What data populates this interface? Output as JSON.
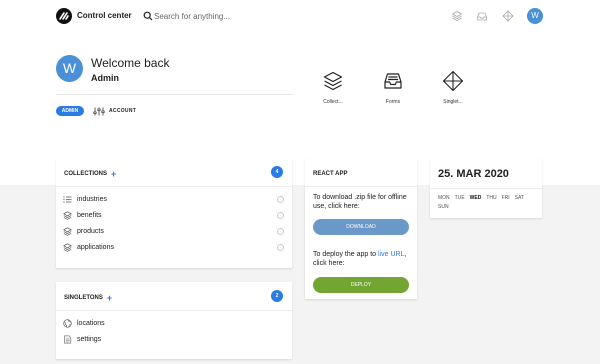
{
  "topbar": {
    "app_title": "Control center",
    "search_placeholder": "Search for anything...",
    "avatar_letter": "W"
  },
  "welcome": {
    "avatar_letter": "W",
    "greeting": "Welcome back",
    "username": "Admin",
    "role_badge": "ADMIN",
    "account_label": "ACCOUNT"
  },
  "quick_links": [
    {
      "label": "Collect...",
      "icon": "layers-icon"
    },
    {
      "label": "Forms",
      "icon": "inbox-icon"
    },
    {
      "label": "Singlet...",
      "icon": "diamond-icon"
    }
  ],
  "collections": {
    "title": "COLLECTIONS",
    "count": "4",
    "items": [
      {
        "label": "industries",
        "icon": "list-icon"
      },
      {
        "label": "benefits",
        "icon": "layers-icon"
      },
      {
        "label": "products",
        "icon": "layers-icon"
      },
      {
        "label": "applications",
        "icon": "layers-icon"
      }
    ]
  },
  "singletons": {
    "title": "SINGLETONS",
    "count": "2",
    "items": [
      {
        "label": "locations",
        "icon": "globe-icon"
      },
      {
        "label": "settings",
        "icon": "document-icon"
      }
    ]
  },
  "react_app": {
    "title": "REACT APP",
    "download_text": "To download .zip file for offline use, click here:",
    "download_button": "DOWNLOAD",
    "deploy_text_before": "To deploy the app to ",
    "deploy_link": "live URL",
    "deploy_text_after": ", click here:",
    "deploy_button": "DEPLOY"
  },
  "calendar": {
    "date": "25. MAR 2020",
    "weekdays": [
      "MON",
      "TUE",
      "WED",
      "THU",
      "FRI",
      "SAT",
      "SUN"
    ],
    "today": "WED"
  },
  "colors": {
    "accent": "#2a7be4",
    "avatar": "#4a90d9",
    "download_button": "#6a98c9",
    "deploy_button": "#73a532"
  }
}
